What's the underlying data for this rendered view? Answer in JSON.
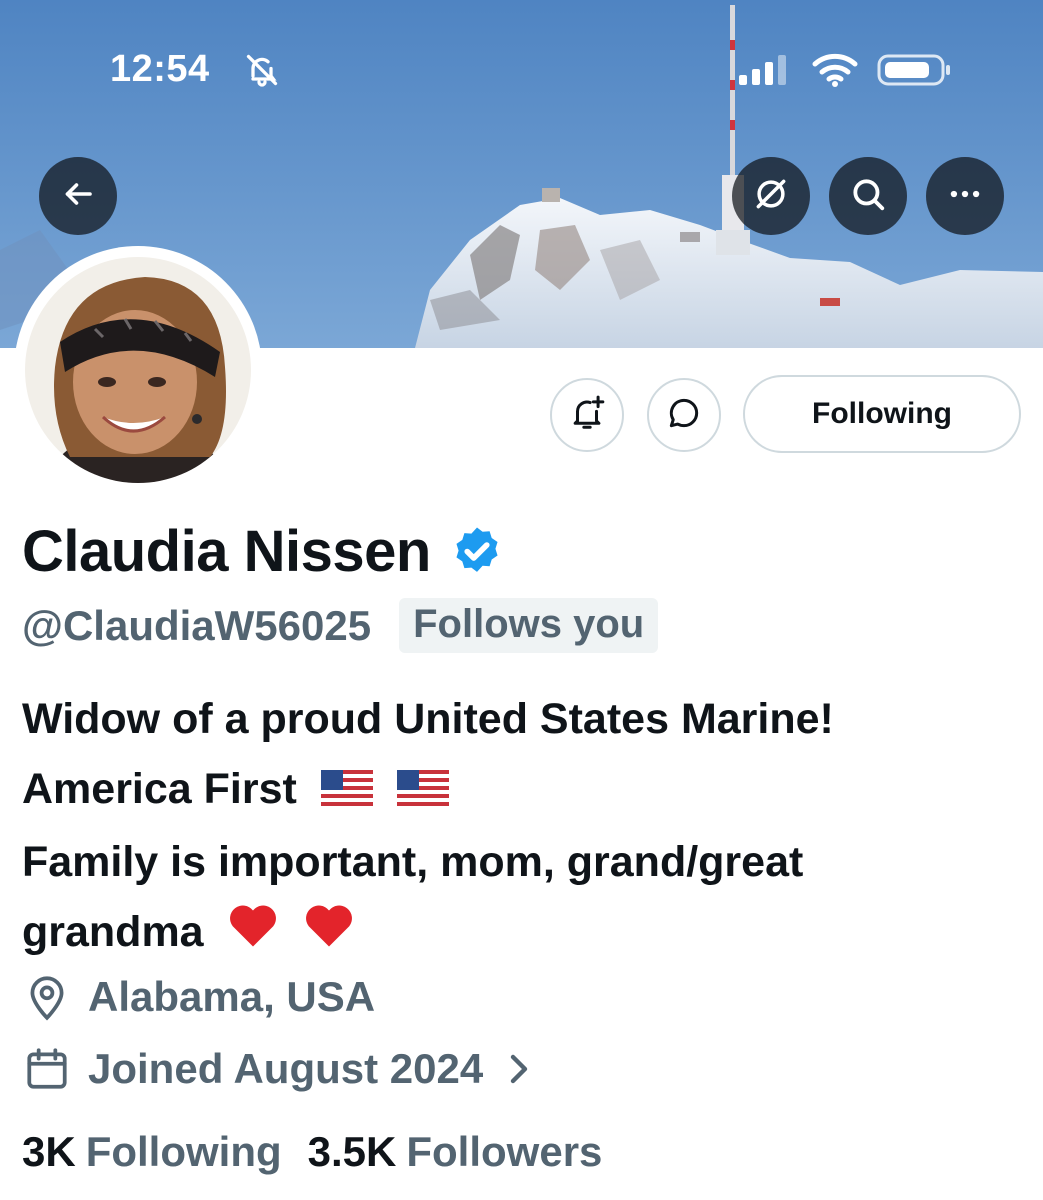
{
  "status_bar": {
    "time": "12:54"
  },
  "profile": {
    "display_name": "Claudia Nissen",
    "handle": "@ClaudiaW56025",
    "follows_you": "Follows you",
    "following_button": "Following",
    "bio": {
      "line1": "Widow of a proud United States Marine!",
      "line2": "America First",
      "line3": "Family is important, mom, grand/great",
      "line4": "grandma"
    },
    "location": "Alabama, USA",
    "joined": "Joined August 2024",
    "following_count": "3K",
    "following_label": "Following",
    "followers_count": "3.5K",
    "followers_label": "Followers"
  },
  "icons": {
    "back": "back-arrow-icon",
    "unfollow_topic": "circle-slash-icon",
    "search": "search-icon",
    "more": "more-icon",
    "notify": "bell-plus-icon",
    "message": "message-icon",
    "verified": "verified-badge-icon",
    "location": "location-pin-icon",
    "calendar": "calendar-icon"
  },
  "colors": {
    "accent_blue": "#1d9bf0",
    "secondary_text": "#536471",
    "primary_text": "#0f1419",
    "border": "#cfd9de"
  }
}
